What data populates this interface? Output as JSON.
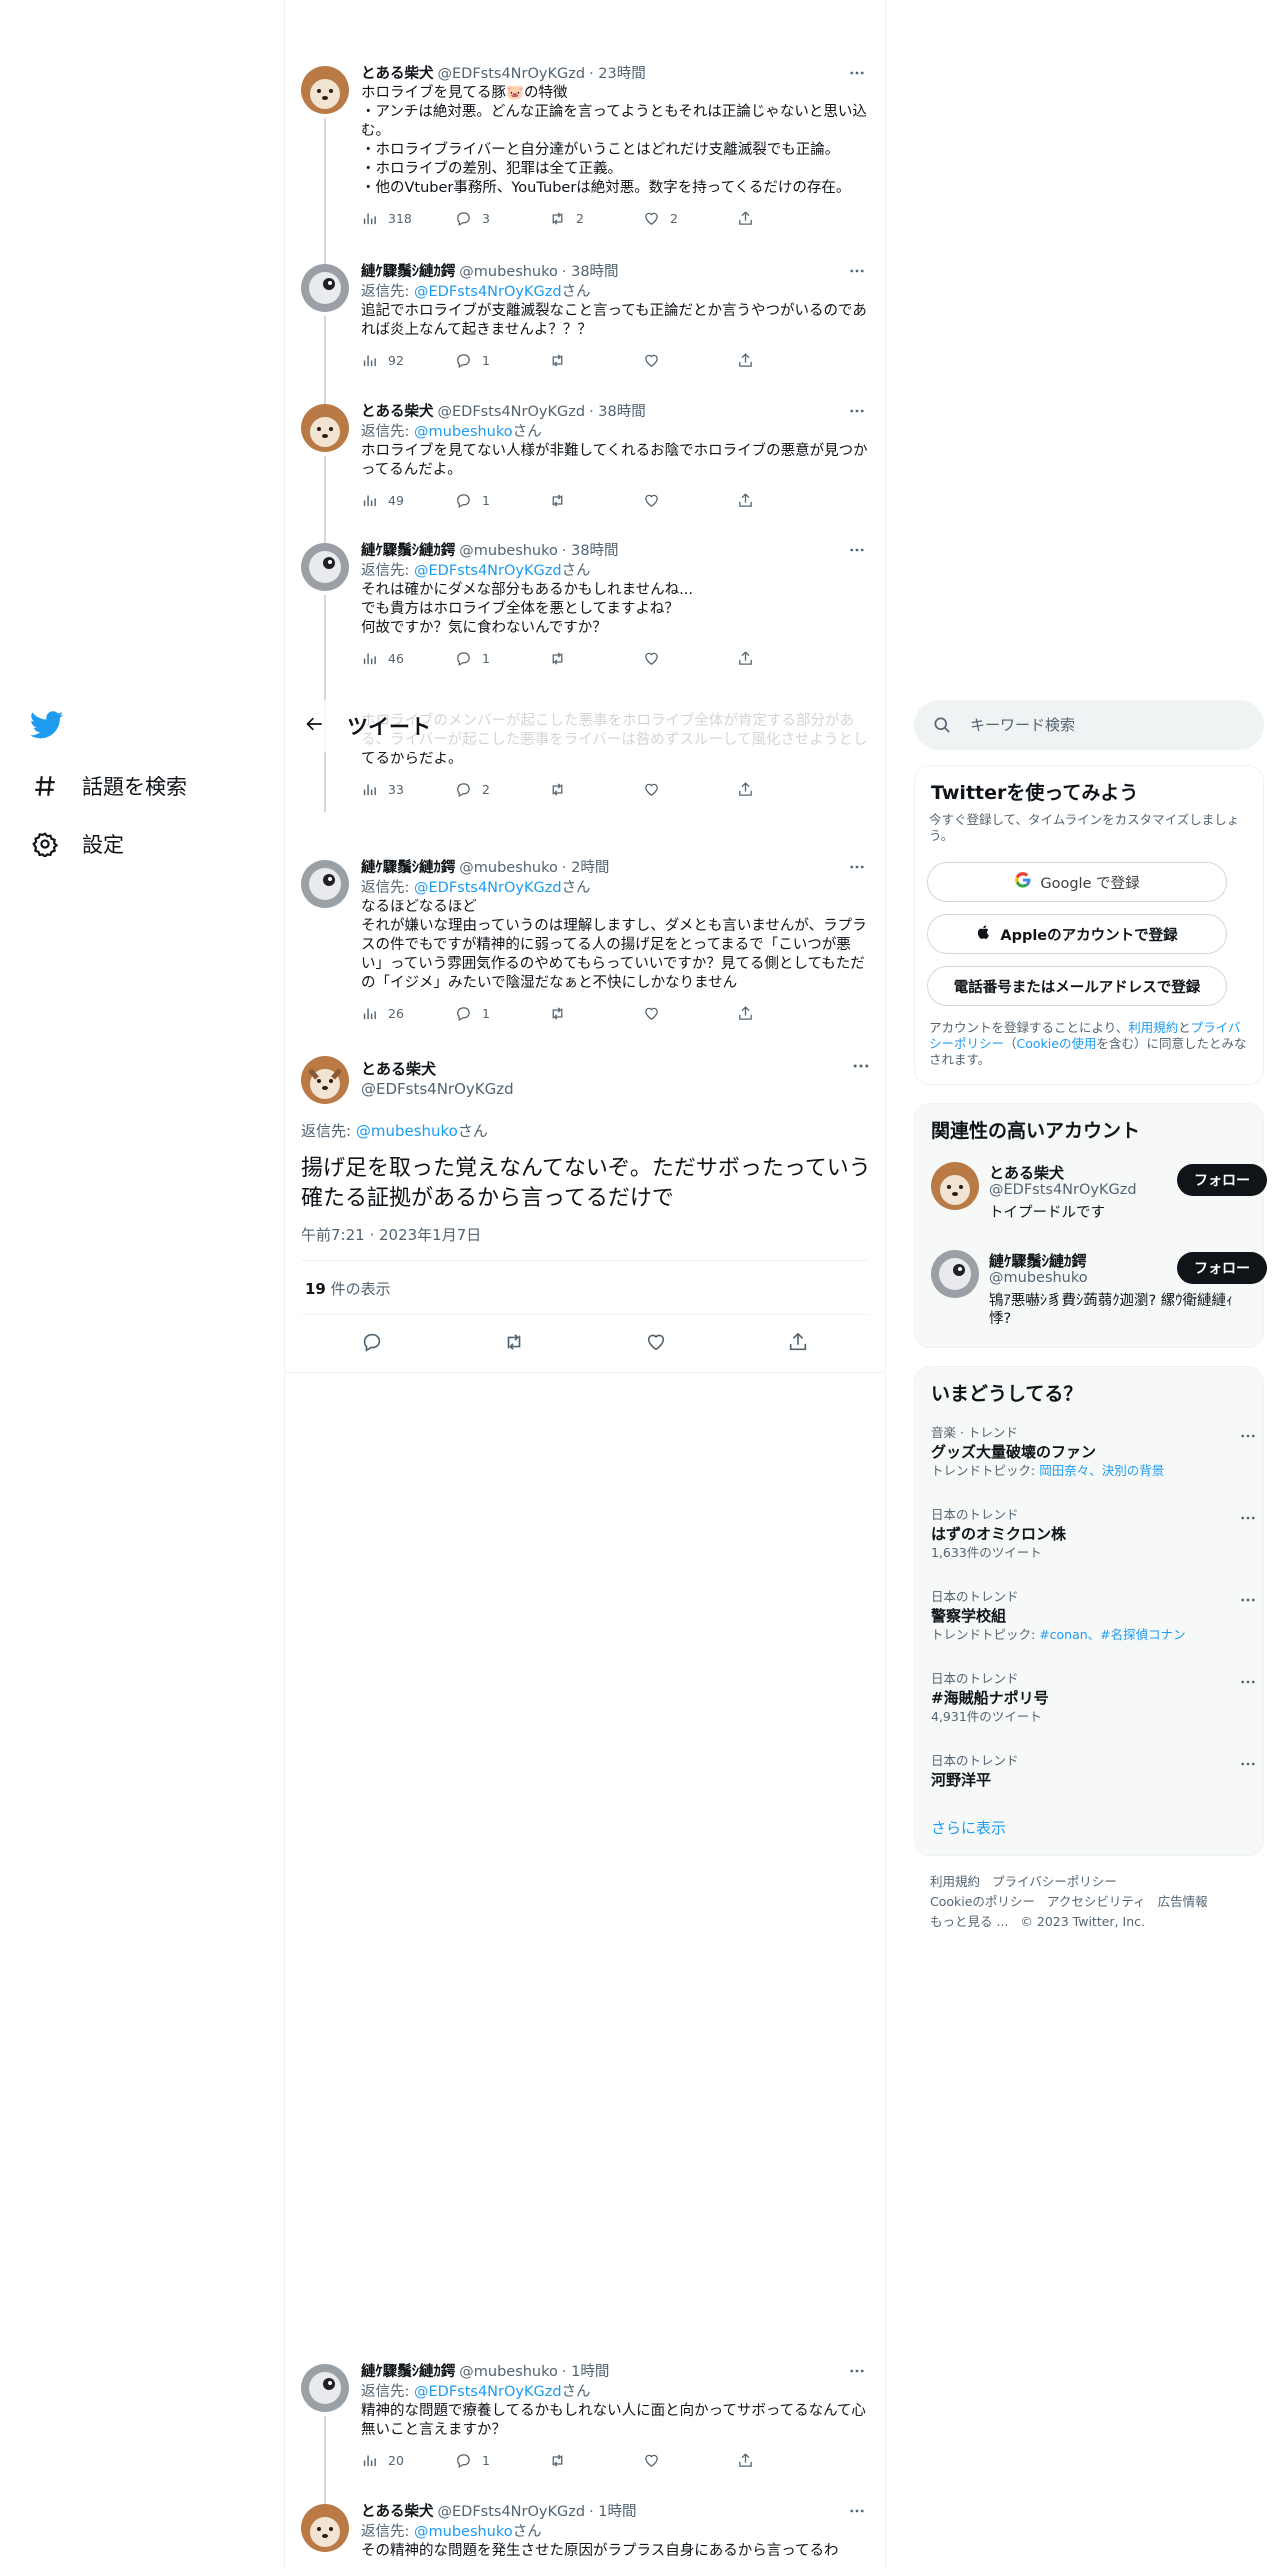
{
  "nav": {
    "items": [
      {
        "label": "話題を検索",
        "icon": "hash-icon"
      },
      {
        "label": "設定",
        "icon": "gear-icon"
      }
    ]
  },
  "header": {
    "title": "ツイート"
  },
  "tweets": [
    {
      "name": "とある柴犬",
      "handle": "@EDFsts4NrOyKGzd",
      "time": "· 23時間",
      "reply_to": "",
      "text": "ホロライブを見てる豚🐷の特徴\n・アンチは絶対悪。どんな正論を言ってようともそれは正論じゃないと思い込む。\n・ホロライブライバーと自分達がいうことはどれだけ支離滅裂でも正論。\n・ホロライブの差別、犯罪は全て正義。\n・他のVtuber事務所、YouTuberは絶対悪。数字を持ってくるだけの存在。",
      "views": "318",
      "replies": "3",
      "retweets": "2",
      "likes": "2"
    },
    {
      "name": "縺ｹ驟鬚ｼ縺ｶ鍔",
      "handle": "@mubeshuko",
      "time": "· 38時間",
      "reply_to": "@EDFsts4NrOyKGzd",
      "text": "追記でホロライブが支離滅裂なこと言っても正論だとか言うやつがいるのであれば炎上なんて起きませんよ？？？",
      "views": "92",
      "replies": "1",
      "retweets": "",
      "likes": ""
    },
    {
      "name": "とある柴犬",
      "handle": "@EDFsts4NrOyKGzd",
      "time": "· 38時間",
      "reply_to": "@mubeshuko",
      "text": "ホロライブを見てない人様が非難してくれるお陰でホロライブの悪意が見つかってるんだよ。",
      "views": "49",
      "replies": "1",
      "retweets": "",
      "likes": ""
    },
    {
      "name": "縺ｹ驟鬚ｼ縺ｶ鍔",
      "handle": "@mubeshuko",
      "time": "· 38時間",
      "reply_to": "@EDFsts4NrOyKGzd",
      "text": "それは確かにダメな部分もあるかもしれませんね...\nでも貴方はホロライブ全体を悪としてますよね？\n何故ですか？気に食わないんですか？",
      "views": "46",
      "replies": "1",
      "retweets": "",
      "likes": ""
    },
    {
      "name": "",
      "handle": "",
      "time": "",
      "reply_to": "",
      "text": "ホロライブのメンバーが起こした悪事をホロライブ全体が肯定する部分がある、ライバーが起こした悪事をライバーは咎めずスルーして風化させようとしてるからだよ。",
      "views": "33",
      "replies": "2",
      "retweets": "",
      "likes": ""
    },
    {
      "name": "縺ｹ驟鬚ｼ縺ｶ鍔",
      "handle": "@mubeshuko",
      "time": "· 2時間",
      "reply_to": "@EDFsts4NrOyKGzd",
      "text": "なるほどなるほど\nそれが嫌いな理由っていうのは理解しますし、ダメとも言いませんが、ラプラスの件でもですが精神的に弱ってる人の揚げ足をとってまるで「こいつが悪い」っていう雰囲気作るのやめてもらっていいですか？見てる側としてもただの「イジメ」みたいで陰湿だなぁと不快にしかなりません",
      "views": "26",
      "replies": "1",
      "retweets": "",
      "likes": ""
    },
    {
      "name": "縺ｹ驟鬚ｼ縺ｶ鍔",
      "handle": "@mubeshuko",
      "time": "· 1時間",
      "reply_to": "@EDFsts4NrOyKGzd",
      "text": "精神的な問題で療養してるかもしれない人に面と向かってサボってるなんて心無いこと言えますか？",
      "views": "20",
      "replies": "1",
      "retweets": "",
      "likes": ""
    },
    {
      "name": "とある柴犬",
      "handle": "@EDFsts4NrOyKGzd",
      "time": "· 1時間",
      "reply_to": "@mubeshuko",
      "text": "その精神的な問題を発生させた原因がラプラス自身にあるから言ってるわ",
      "views": "",
      "replies": "",
      "retweets": "",
      "likes": ""
    }
  ],
  "reply_prefix": "返信先: ",
  "reply_suffix": "さん",
  "focal": {
    "name": "とある柴犬",
    "handle": "@EDFsts4NrOyKGzd",
    "reply_prefix": "返信先: ",
    "reply_to": "@mubeshuko",
    "reply_suffix": "さん",
    "text": "揚げ足を取った覚えなんてないぞ。ただサボったっていう確たる証拠があるから言ってるだけで",
    "date": "午前7:21 · 2023年1月7日",
    "views_count": "19",
    "views_label": " 件の表示"
  },
  "search": {
    "placeholder": "キーワード検索"
  },
  "signup": {
    "title": "Twitterを使ってみよう",
    "subtitle": "今すぐ登録して、タイムラインをカスタマイズしましょう。",
    "google": "Google で登録",
    "apple": "Appleのアカウントで登録",
    "phone": "電話番号またはメールアドレスで登録",
    "terms_a": "アカウントを登録することにより、",
    "terms_link1": "利用規約",
    "terms_b": "と",
    "terms_link2": "プライバシーポリシー",
    "terms_c": "（",
    "terms_link3": "Cookieの使用",
    "terms_d": "を含む）に同意したとみなされます。"
  },
  "related": {
    "title": "関連性の高いアカウント",
    "accounts": [
      {
        "name": "とある柴犬",
        "handle": "@EDFsts4NrOyKGzd",
        "bio": "トイプードルです",
        "follow": "フォロー"
      },
      {
        "name": "縺ｹ驟鬚ｼ縺ｶ鍔",
        "handle": "@mubeshuko",
        "bio": "鴇ｱ悪嚇ｼ豸費ｼ蒟蒻ｸ迦瀏? 縲ｳ衛縺縺ｨ悸?",
        "follow": "フォロー"
      }
    ]
  },
  "trends": {
    "title": "いまどうしてる？",
    "items": [
      {
        "cat": "音楽 · トレンド",
        "title": "グッズ大量破壊のファン",
        "meta_prefix": "トレンドトピック: ",
        "meta_link": "岡田奈々、決別の背景"
      },
      {
        "cat": "日本のトレンド",
        "title": "はずのオミクロン株",
        "meta_prefix": "1,633件のツイート",
        "meta_link": ""
      },
      {
        "cat": "日本のトレンド",
        "title": "警察学校組",
        "meta_prefix": "トレンドトピック: ",
        "meta_link": "#conan、#名探偵コナン"
      },
      {
        "cat": "日本のトレンド",
        "title": "#海賊船ナポリ号",
        "meta_prefix": "4,931件のツイート",
        "meta_link": ""
      },
      {
        "cat": "日本のトレンド",
        "title": "河野洋平",
        "meta_prefix": "",
        "meta_link": ""
      }
    ],
    "show_more": "さらに表示"
  },
  "footer": {
    "line1": [
      "利用規約",
      "プライバシーポリシー"
    ],
    "line2": [
      "Cookieのポリシー",
      "アクセシビリティ",
      "広告情報"
    ],
    "line3": [
      "もっと見る ...",
      "© 2023 Twitter, Inc."
    ]
  },
  "colors": {
    "accent": "#1d9bf0",
    "text": "#0f1419",
    "muted": "#536471"
  }
}
